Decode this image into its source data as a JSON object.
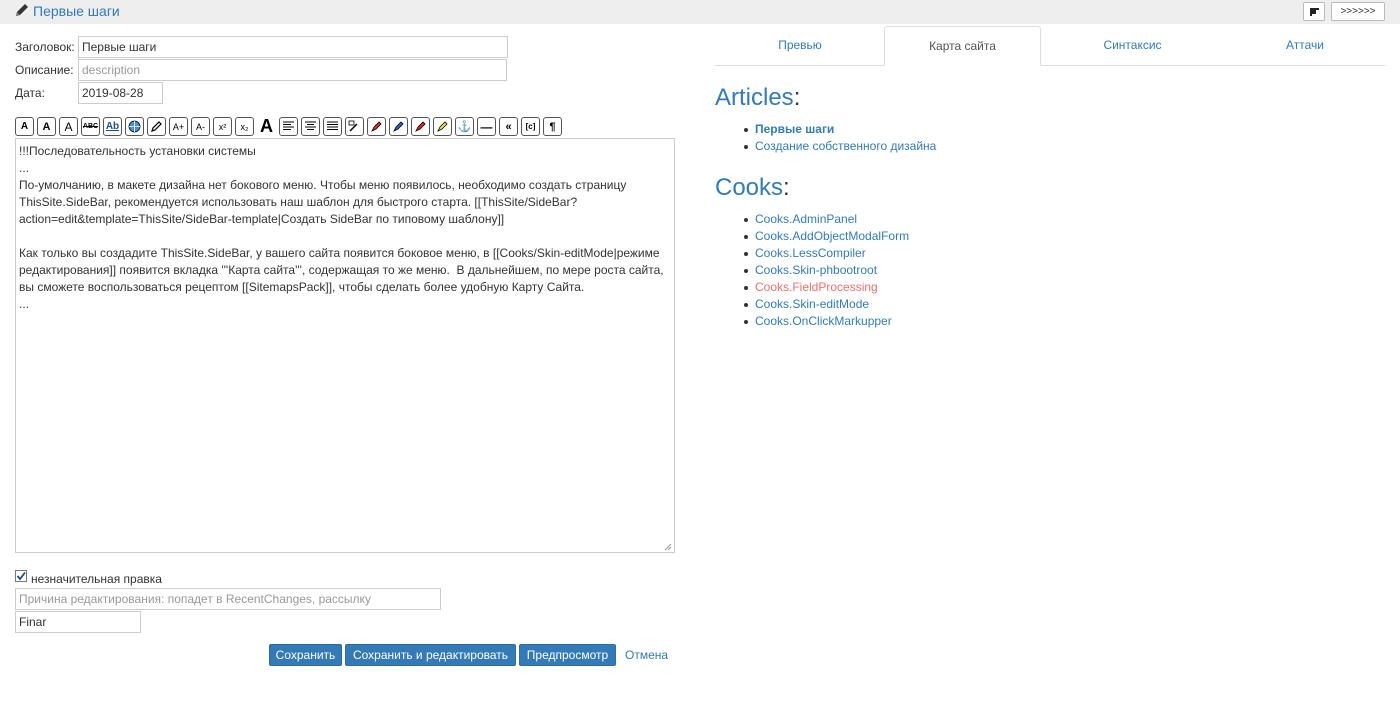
{
  "header": {
    "title": "Первые шаги",
    "layout_button_icon": "layout-icon",
    "more_button_label": ">>>>>>"
  },
  "form": {
    "title_label": "Заголовок:",
    "title_value": "Первые шаги",
    "description_label": "Описание:",
    "description_placeholder": "description",
    "date_label": "Дата:",
    "date_value": "2019-08-28",
    "toolbar_icons": [
      "font-small-icon",
      "font-bold-icon",
      "font-large-icon",
      "strikethrough-icon",
      "underline-link-icon",
      "globe-link-icon",
      "pencil-icon",
      "font-increase-icon",
      "font-decrease-icon",
      "superscript-icon",
      "subscript-icon",
      "big-a-icon",
      "align-left-icon",
      "align-center-icon",
      "align-justify-icon",
      "table-icon",
      "red-highlight-icon",
      "blue-highlight-icon",
      "red-marker-icon",
      "yellow-marker-icon",
      "anchor-icon",
      "hr-icon",
      "quote-icon",
      "code-icon",
      "paragraph-icon"
    ],
    "toolbar_labels": [
      "A",
      "A",
      "A",
      "ABC",
      "Ab",
      "",
      "",
      "A+",
      "A-",
      "x²",
      "x₂",
      "A",
      "",
      "",
      "",
      "",
      "",
      "",
      "",
      "",
      "⚓",
      "—",
      "«",
      "[c]",
      "¶"
    ],
    "editor_text": "!!!Последовательность установки системы\n...\nПо-умолчанию, в макете дизайна нет бокового меню. Чтобы меню появилось, необходимо создать страницу ThisSite.SideBar, рекомендуется использовать наш шаблон для быстрого старта. [[ThisSite/SideBar?action=edit&template=ThisSite/SideBar-template|Создать SideBar по типовому шаблону]]\n\nКак только вы создадите ThisSite.SideBar, у вашего сайта появится боковое меню, в [[Cooks/Skin-editMode|режиме редактирования]] появится вкладка '''Карта сайта''', содержащая то же меню.  В дальнейшем, по мере роста сайта, вы сможете воспользоваться рецептом [[SitemapsPack]], чтобы сделать более удобную Карту Сайта.\n...",
    "minor_edit_label": "незначительная правка",
    "minor_edit_checked": true,
    "reason_placeholder": "Причина редактирования: попадет в RecentChanges, рассылку",
    "author_value": "Finar",
    "buttons": {
      "save": "Сохранить",
      "save_edit": "Сохранить и редактировать",
      "preview": "Предпросмотр",
      "cancel": "Отмена"
    }
  },
  "tabs": [
    {
      "label": "Превью",
      "active": false
    },
    {
      "label": "Карта сайта",
      "active": true
    },
    {
      "label": "Синтаксис",
      "active": false
    },
    {
      "label": "Аттачи",
      "active": false
    }
  ],
  "sitemap": {
    "articles_heading": "Articles",
    "articles": [
      {
        "label": "Первые шаги",
        "current": true
      },
      {
        "label": "Создание собственного дизайна",
        "current": false
      }
    ],
    "cooks_heading": "Cooks",
    "cooks": [
      {
        "label": "Cooks.AdminPanel",
        "missing": false
      },
      {
        "label": "Cooks.AddObjectModalForm",
        "missing": false
      },
      {
        "label": "Cooks.LessCompiler",
        "missing": false
      },
      {
        "label": "Cooks.Skin-phbootroot",
        "missing": false
      },
      {
        "label": "Cooks.FieldProcessing",
        "missing": true
      },
      {
        "label": "Cooks.Skin-editMode",
        "missing": false
      },
      {
        "label": "Cooks.OnClickMarkupper",
        "missing": false
      }
    ]
  },
  "colors": {
    "link": "#337ab7",
    "button": "#337ab7",
    "missing_link": "#e8716f",
    "header_bg": "#eeeeee"
  }
}
